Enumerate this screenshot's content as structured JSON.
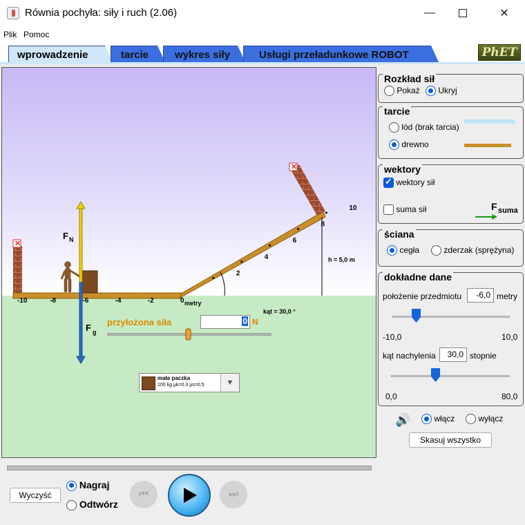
{
  "window": {
    "title": "Równia pochyła: siły i ruch (2.06)"
  },
  "menu": {
    "file": "Plik",
    "help": "Pomoc"
  },
  "tabs": [
    "wprowadzenie",
    "tarcie",
    "wykres siły",
    "Usługi przeładunkowe ROBOT"
  ],
  "logo": "PhET",
  "play_area": {
    "ticks": [
      {
        "label": "-10",
        "pos": -10
      },
      {
        "label": "-8",
        "pos": -8
      },
      {
        "label": "-6",
        "pos": -6
      },
      {
        "label": "-4",
        "pos": -4
      },
      {
        "label": "-2",
        "pos": -2
      },
      {
        "label": "0",
        "pos": 0
      },
      {
        "label": "2",
        "pos": 2
      },
      {
        "label": "4",
        "pos": 4
      },
      {
        "label": "6",
        "pos": 6
      },
      {
        "label": "8",
        "pos": 8
      },
      {
        "label": "10",
        "pos": 10
      }
    ],
    "units": "metry",
    "height_label": "h = 5,0 m",
    "angle_label": "kąt = 30,0 °",
    "fn_label": "F",
    "fn_sub": "N",
    "fg_label": "F",
    "fg_sub": "g",
    "applied_force_label": "przyłożona siła",
    "applied_force_value": "0",
    "applied_force_unit": "N",
    "object": {
      "name": "mała paczka",
      "details": "100 kg μk=0.3 μs=0.5"
    }
  },
  "panels": {
    "forces": {
      "title": "Rozkład sił",
      "show": "Pokaż",
      "hide": "Ukryj",
      "selected": "Ukryj"
    },
    "friction": {
      "title": "tarcie",
      "ice": "lód (brak tarcia)",
      "wood": "drewno",
      "selected": "drewno"
    },
    "vectors": {
      "title": "wektory",
      "force_vectors": "wektory sił",
      "sum_forces": "suma sił",
      "fsum_label": "F",
      "fsum_sub": "suma"
    },
    "wall": {
      "title": "ściana",
      "brick": "cegła",
      "spring": "zderzak (sprężyna)",
      "selected": "cegła"
    },
    "precise": {
      "title": "dokładne dane",
      "position_label": "położenie przedmiotu",
      "position_value": "-6,0",
      "position_unit": "metry",
      "position_min": "-10,0",
      "position_max": "10,0",
      "angle_label": "kąt nachylenia",
      "angle_value": "30,0",
      "angle_unit": "stopnie",
      "angle_min": "0,0",
      "angle_max": "80,0"
    },
    "sound": {
      "on": "włącz",
      "off": "wyłącz",
      "selected": "włącz"
    },
    "reset_all": "Skasuj wszystko"
  },
  "controls": {
    "clear": "Wyczyść",
    "record": "Nagraj",
    "playback": "Odtwórz",
    "selected": "Nagraj"
  },
  "colors": {
    "tab_blue": "#3b6fe0",
    "tab_active": "#cfe6fb",
    "ramp_wood": "#c98f28",
    "force_yellow": "#f0d000",
    "force_blue": "#2b6cc4",
    "ground": "#c6ebc4",
    "accent": "#0a5bd6"
  }
}
